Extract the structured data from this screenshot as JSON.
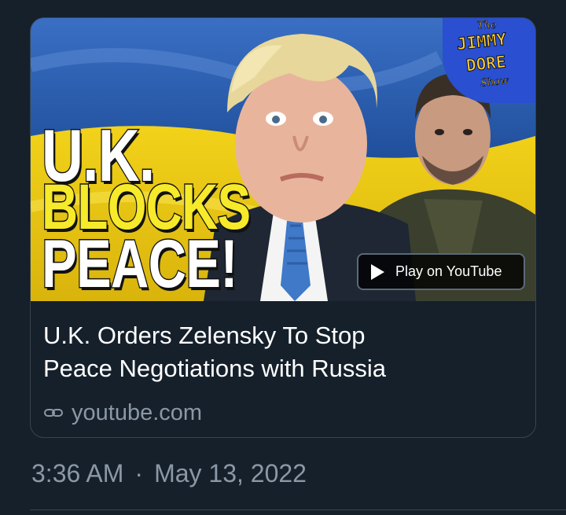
{
  "card": {
    "thumbnail": {
      "headline_line1": "U.K.",
      "headline_line2": "BLOCKS",
      "headline_line3": "PEACE!",
      "logo_the": "The",
      "logo_jimmy": "JIMMY",
      "logo_dore": "DORE",
      "logo_show": "Show",
      "play_button_label": "Play on YouTube",
      "play_icon": "play-icon",
      "accent_yellow": "#f6ea2a",
      "flag_blue": "#2c5aa8"
    },
    "title_line1": "U.K. Orders Zelensky To Stop",
    "title_line2": "Peace Negotiations with Russia",
    "domain": "youtube.com",
    "domain_icon": "link-icon"
  },
  "tweet": {
    "time": "3:36 AM",
    "separator": "·",
    "date": "May 13, 2022"
  },
  "colors": {
    "background": "#15202b",
    "border": "#38444d",
    "secondary_text": "#8b98a5"
  }
}
